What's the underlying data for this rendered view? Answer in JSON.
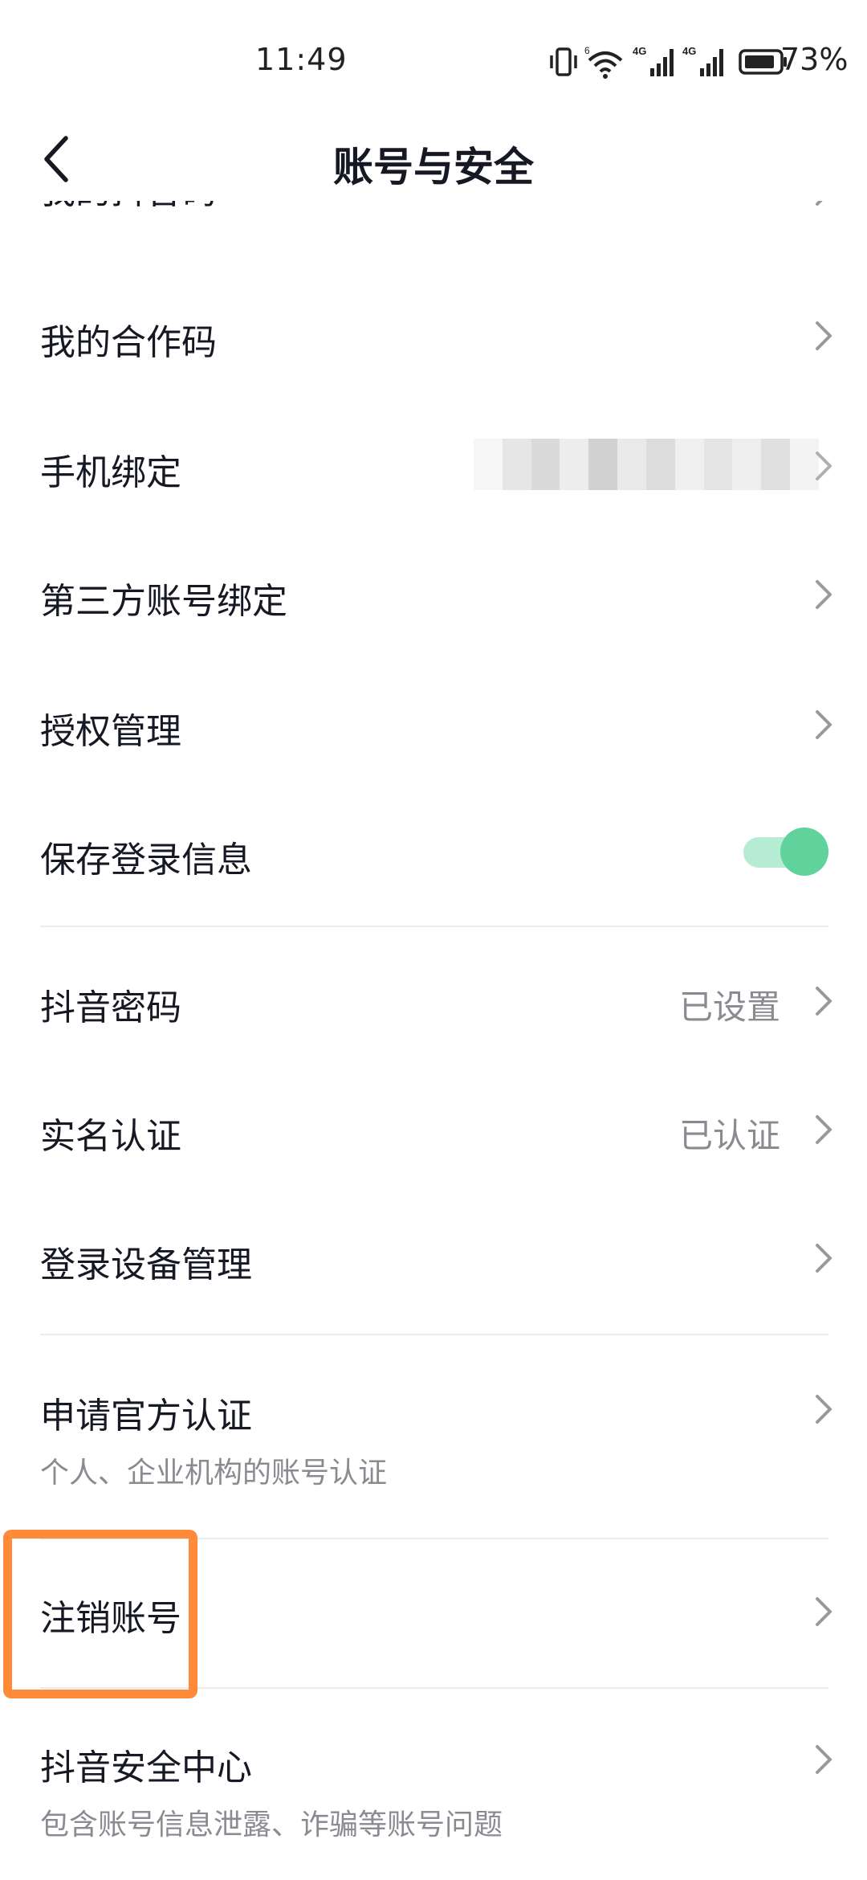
{
  "status_bar": {
    "time": "11:49",
    "signal_label_1": "4G",
    "signal_label_2": "4G",
    "wifi_label": "6",
    "battery_percent": "73%",
    "icons": [
      "vibrate-icon",
      "wifi-icon",
      "signal-icon",
      "signal-icon",
      "battery-icon"
    ]
  },
  "nav": {
    "back_icon": "chevron-left-icon",
    "title": "账号与安全"
  },
  "list": {
    "partial_top_label": "我的抖音码",
    "items": {
      "cooperation_code": {
        "label": "我的合作码"
      },
      "phone_binding": {
        "label": "手机绑定",
        "value_blurred": true
      },
      "third_party_binding": {
        "label": "第三方账号绑定"
      },
      "authorization": {
        "label": "授权管理"
      },
      "save_login": {
        "label": "保存登录信息",
        "toggle_on": true
      },
      "password": {
        "label": "抖音密码",
        "value": "已设置"
      },
      "real_name": {
        "label": "实名认证",
        "value": "已认证"
      },
      "devices": {
        "label": "登录设备管理"
      },
      "official_verify": {
        "label": "申请官方认证",
        "sub": "个人、企业机构的账号认证"
      },
      "delete_account": {
        "label": "注销账号",
        "highlighted": true
      },
      "security_center": {
        "label": "抖音安全中心",
        "sub": "包含账号信息泄露、诈骗等账号问题"
      }
    }
  },
  "colors": {
    "text_primary": "#161823",
    "text_secondary": "#8a8b91",
    "divider": "#ececec",
    "toggle_track": "#b6ecd3",
    "toggle_knob": "#5fd39b",
    "highlight": "#ff8a3a",
    "chevron": "#9a9a9e"
  }
}
